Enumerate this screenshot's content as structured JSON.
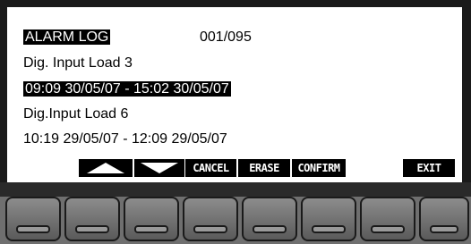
{
  "log": {
    "title": "ALARM LOG",
    "counter": "001/095",
    "entries": [
      {
        "name": "Dig. Input Load 3",
        "period": "09:09 30/05/07 - 15:02 30/05/07"
      },
      {
        "name": "Dig.Input Load 6",
        "period": "10:19 29/05/07 - 12:09 29/05/07"
      }
    ]
  },
  "softkeys": {
    "up_icon": "up-arrow-icon",
    "down_icon": "down-arrow-icon",
    "cancel": "CANCEL",
    "erase": "ERASE",
    "confirm": "CONFIRM",
    "exit": "EXIT"
  },
  "colors": {
    "display_bg": "#ffffff",
    "display_fg": "#000000",
    "bezel": "#1a1a1a",
    "keys": "#6f6f6f"
  }
}
